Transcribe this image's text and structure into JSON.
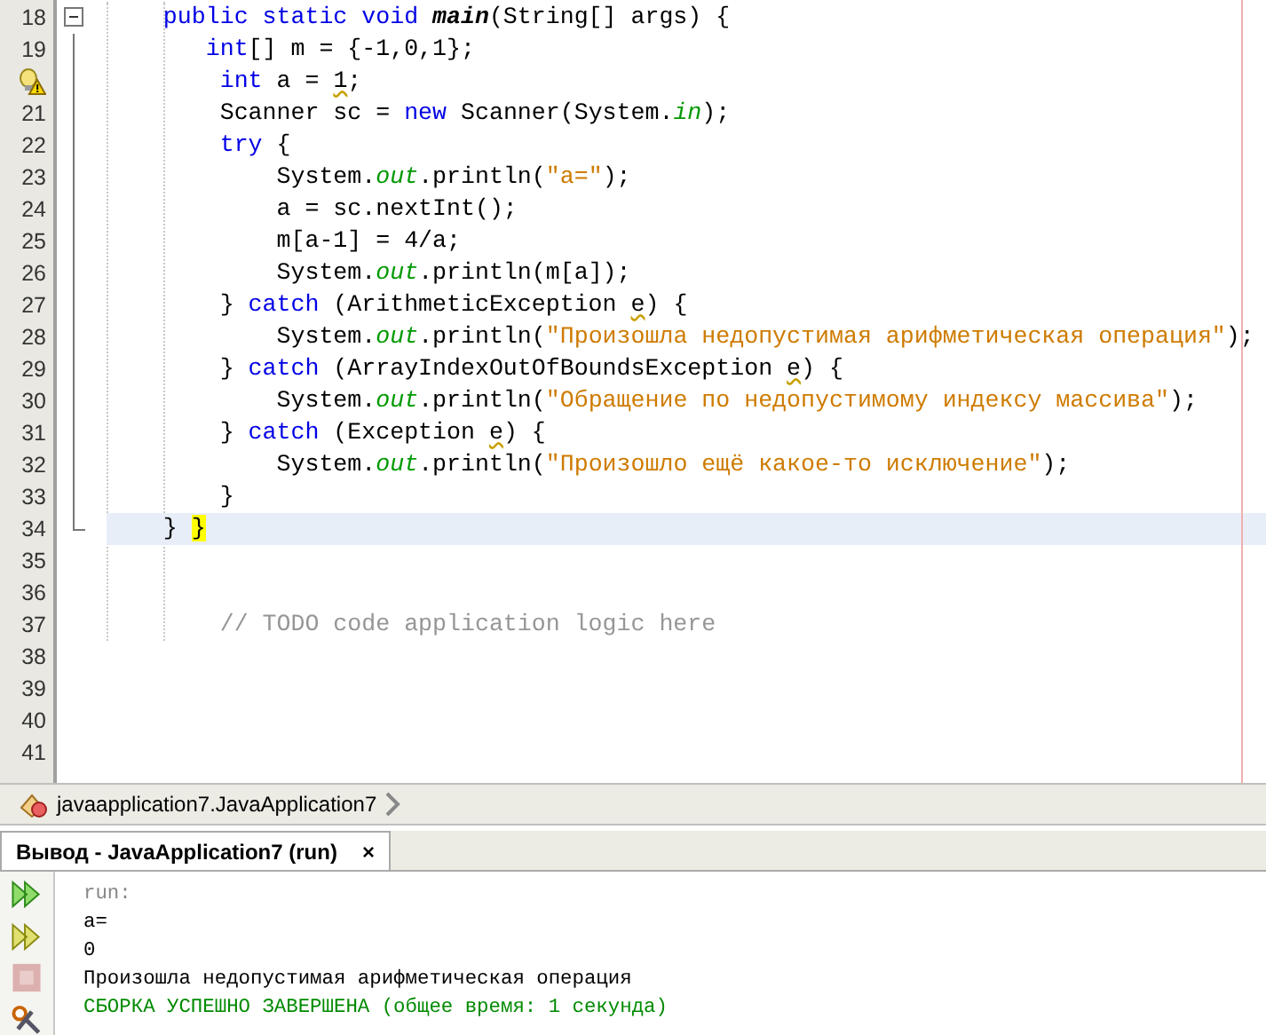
{
  "editor": {
    "lines": [
      {
        "number": "18",
        "expanded": true,
        "tokens": [
          {
            "kind": "kw",
            "text": "    public static void "
          },
          {
            "kind": "method",
            "text": "main"
          },
          {
            "kind": "plain",
            "text": "(String[] args) {"
          }
        ]
      },
      {
        "number": "19",
        "tokens": [
          {
            "kind": "kw",
            "text": "       int"
          },
          {
            "kind": "plain",
            "text": "[] m = {-1,0,1};"
          }
        ]
      },
      {
        "warning": true,
        "tokens": [
          {
            "kind": "kw",
            "text": "        int"
          },
          {
            "kind": "plain",
            "text": " a = "
          },
          {
            "kind": "squiggle",
            "text": "1"
          },
          {
            "kind": "plain",
            "text": ";"
          }
        ]
      },
      {
        "number": "21",
        "tokens": [
          {
            "kind": "plain",
            "text": "        Scanner sc = "
          },
          {
            "kind": "kw",
            "text": "new"
          },
          {
            "kind": "plain",
            "text": " Scanner(System."
          },
          {
            "kind": "field",
            "text": "in"
          },
          {
            "kind": "plain",
            "text": ");"
          }
        ]
      },
      {
        "number": "22",
        "tokens": [
          {
            "kind": "kw",
            "text": "        try"
          },
          {
            "kind": "plain",
            "text": " {"
          }
        ]
      },
      {
        "number": "23",
        "tokens": [
          {
            "kind": "plain",
            "text": "            System."
          },
          {
            "kind": "field",
            "text": "out"
          },
          {
            "kind": "plain",
            "text": ".println("
          },
          {
            "kind": "str",
            "text": "\"a=\""
          },
          {
            "kind": "plain",
            "text": ");"
          }
        ]
      },
      {
        "number": "24",
        "tokens": [
          {
            "kind": "plain",
            "text": "            a = sc.nextInt();"
          }
        ]
      },
      {
        "number": "25",
        "tokens": [
          {
            "kind": "plain",
            "text": "            m[a-1] = 4/a;"
          }
        ]
      },
      {
        "number": "26",
        "tokens": [
          {
            "kind": "plain",
            "text": "            System."
          },
          {
            "kind": "field",
            "text": "out"
          },
          {
            "kind": "plain",
            "text": ".println(m[a]);"
          }
        ]
      },
      {
        "number": "27",
        "tokens": [
          {
            "kind": "plain",
            "text": "        } "
          },
          {
            "kind": "kw",
            "text": "catch"
          },
          {
            "kind": "plain",
            "text": " (ArithmeticException "
          },
          {
            "kind": "squiggle",
            "text": "e"
          },
          {
            "kind": "plain",
            "text": ") {"
          }
        ]
      },
      {
        "number": "28",
        "tokens": [
          {
            "kind": "plain",
            "text": "            System."
          },
          {
            "kind": "field",
            "text": "out"
          },
          {
            "kind": "plain",
            "text": ".println("
          },
          {
            "kind": "str",
            "text": "\"Произошла недопустимая арифметическая операция\""
          },
          {
            "kind": "plain",
            "text": ");"
          }
        ]
      },
      {
        "number": "29",
        "tokens": [
          {
            "kind": "plain",
            "text": "        } "
          },
          {
            "kind": "kw",
            "text": "catch"
          },
          {
            "kind": "plain",
            "text": " (ArrayIndexOutOfBoundsException "
          },
          {
            "kind": "squiggle",
            "text": "e"
          },
          {
            "kind": "plain",
            "text": ") {"
          }
        ]
      },
      {
        "number": "30",
        "tokens": [
          {
            "kind": "plain",
            "text": "            System."
          },
          {
            "kind": "field",
            "text": "out"
          },
          {
            "kind": "plain",
            "text": ".println("
          },
          {
            "kind": "str",
            "text": "\"Обращение по недопустимому индексу массива\""
          },
          {
            "kind": "plain",
            "text": ");"
          }
        ]
      },
      {
        "number": "31",
        "tokens": [
          {
            "kind": "plain",
            "text": "        } "
          },
          {
            "kind": "kw",
            "text": "catch"
          },
          {
            "kind": "plain",
            "text": " (Exception "
          },
          {
            "kind": "squiggle",
            "text": "e"
          },
          {
            "kind": "plain",
            "text": ") {"
          }
        ]
      },
      {
        "number": "32",
        "tokens": [
          {
            "kind": "plain",
            "text": "            System."
          },
          {
            "kind": "field",
            "text": "out"
          },
          {
            "kind": "plain",
            "text": ".println("
          },
          {
            "kind": "str",
            "text": "\"Произошло ещё какое-то исключение\""
          },
          {
            "kind": "plain",
            "text": ");"
          }
        ]
      },
      {
        "number": "33",
        "tokens": [
          {
            "kind": "plain",
            "text": "        }"
          }
        ]
      },
      {
        "number": "34",
        "fold_end": true,
        "current": true,
        "tokens": [
          {
            "kind": "plain",
            "text": "    } "
          },
          {
            "kind": "match",
            "text": "}"
          }
        ]
      },
      {
        "number": "35"
      },
      {
        "number": "36"
      },
      {
        "number": "37",
        "tokens": [
          {
            "kind": "comment",
            "text": "        // TODO code application logic here"
          }
        ]
      },
      {
        "number": "38"
      },
      {
        "number": "39"
      },
      {
        "number": "40"
      },
      {
        "number": "41"
      }
    ]
  },
  "breadcrumb": {
    "path": "javaapplication7.JavaApplication7"
  },
  "output": {
    "tab": {
      "title": "Вывод - JavaApplication7 (run)",
      "close": "×",
      "selected": true
    },
    "tools": [
      {
        "kind": "rerun",
        "disabled": false
      },
      {
        "kind": "rerun-params",
        "disabled": false
      },
      {
        "kind": "stop",
        "disabled": true
      },
      {
        "kind": "settings",
        "disabled": false
      }
    ],
    "lines": [
      {
        "kind": "info",
        "text": "run:"
      },
      {
        "kind": "plain",
        "text": "a="
      },
      {
        "kind": "plain",
        "text": "0"
      },
      {
        "kind": "plain",
        "text": "Произошла недопустимая арифметическая операция"
      },
      {
        "kind": "success",
        "text": "СБОРКА УСПЕШНО ЗАВЕРШЕНА (общее время: 1 секунда)"
      }
    ]
  }
}
